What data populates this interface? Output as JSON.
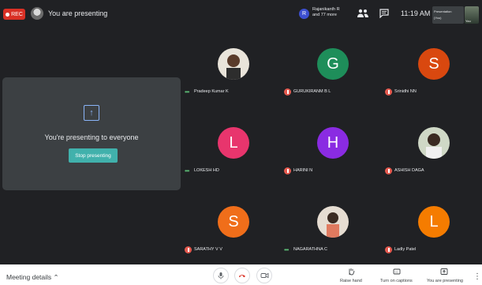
{
  "topbar": {
    "rec_label": "REC",
    "presenting_label": "You are presenting",
    "participant_initial": "R",
    "participant_name_line1": "Rajanikanth R",
    "participant_name_line2": "and 77 more",
    "clock": "11:19 AM",
    "mini_line1": "Presentation",
    "mini_line2": "(You)",
    "self_label": "You"
  },
  "present": {
    "message": "You're presenting to everyone",
    "stop_label": "Stop presenting"
  },
  "participants": [
    {
      "name": "Pradeep Kumar K",
      "initial": "",
      "color": "#d8d0c4",
      "status": "speaking"
    },
    {
      "name": "GURUKIRANM B L",
      "initial": "G",
      "color": "#1e8e5a",
      "status": "muted"
    },
    {
      "name": "Srinidhi NN",
      "initial": "S",
      "color": "#d9480f",
      "status": "muted"
    },
    {
      "name": "LOKESH HD",
      "initial": "L",
      "color": "#e8356d",
      "status": "speaking"
    },
    {
      "name": "HARINI N",
      "initial": "H",
      "color": "#8a2be2",
      "status": "muted"
    },
    {
      "name": "ASHISH DAGA",
      "initial": "",
      "color": "#b7b7a4",
      "status": "muted"
    },
    {
      "name": "SARATHY V V",
      "initial": "S",
      "color": "#f06e1a",
      "status": "muted"
    },
    {
      "name": "NAGARATHNA C",
      "initial": "",
      "color": "#c9b3a2",
      "status": "speaking"
    },
    {
      "name": "Ladly Patel",
      "initial": "L",
      "color": "#f57c00",
      "status": "muted"
    }
  ],
  "bottombar": {
    "meeting_details": "Meeting details",
    "raise_hand": "Raise hand",
    "captions": "Turn on captions",
    "presenting": "You are presenting"
  },
  "colors": {
    "accent": "#41b1ac",
    "rec": "#d93025",
    "background": "#202124",
    "tile": "#3c4043"
  }
}
